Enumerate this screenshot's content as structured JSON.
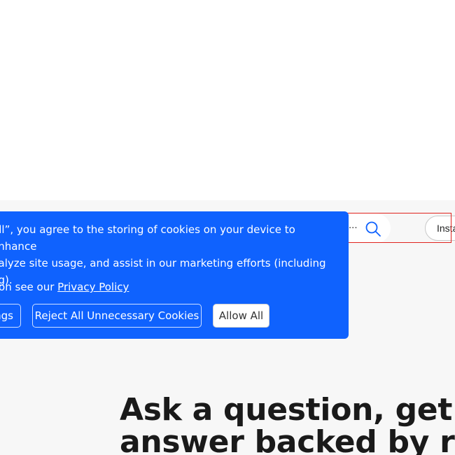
{
  "header": {
    "search_ellipsis": "...",
    "install_label": "Install"
  },
  "cookie_banner": {
    "text": "All”, you agree to the storing of cookies on your device to enhance\nnalyze site usage, and assist in our marketing efforts (including\nng).",
    "info_prefix": "tion see our ",
    "privacy_link": "Privacy Policy",
    "settings_label": "ngs",
    "reject_label": "Reject All Unnecessary Cookies",
    "allow_label": "Allow All",
    "background_color": "#0f62fe"
  },
  "hero": {
    "title": "Ask a question, get an\nanswer backed by real"
  }
}
